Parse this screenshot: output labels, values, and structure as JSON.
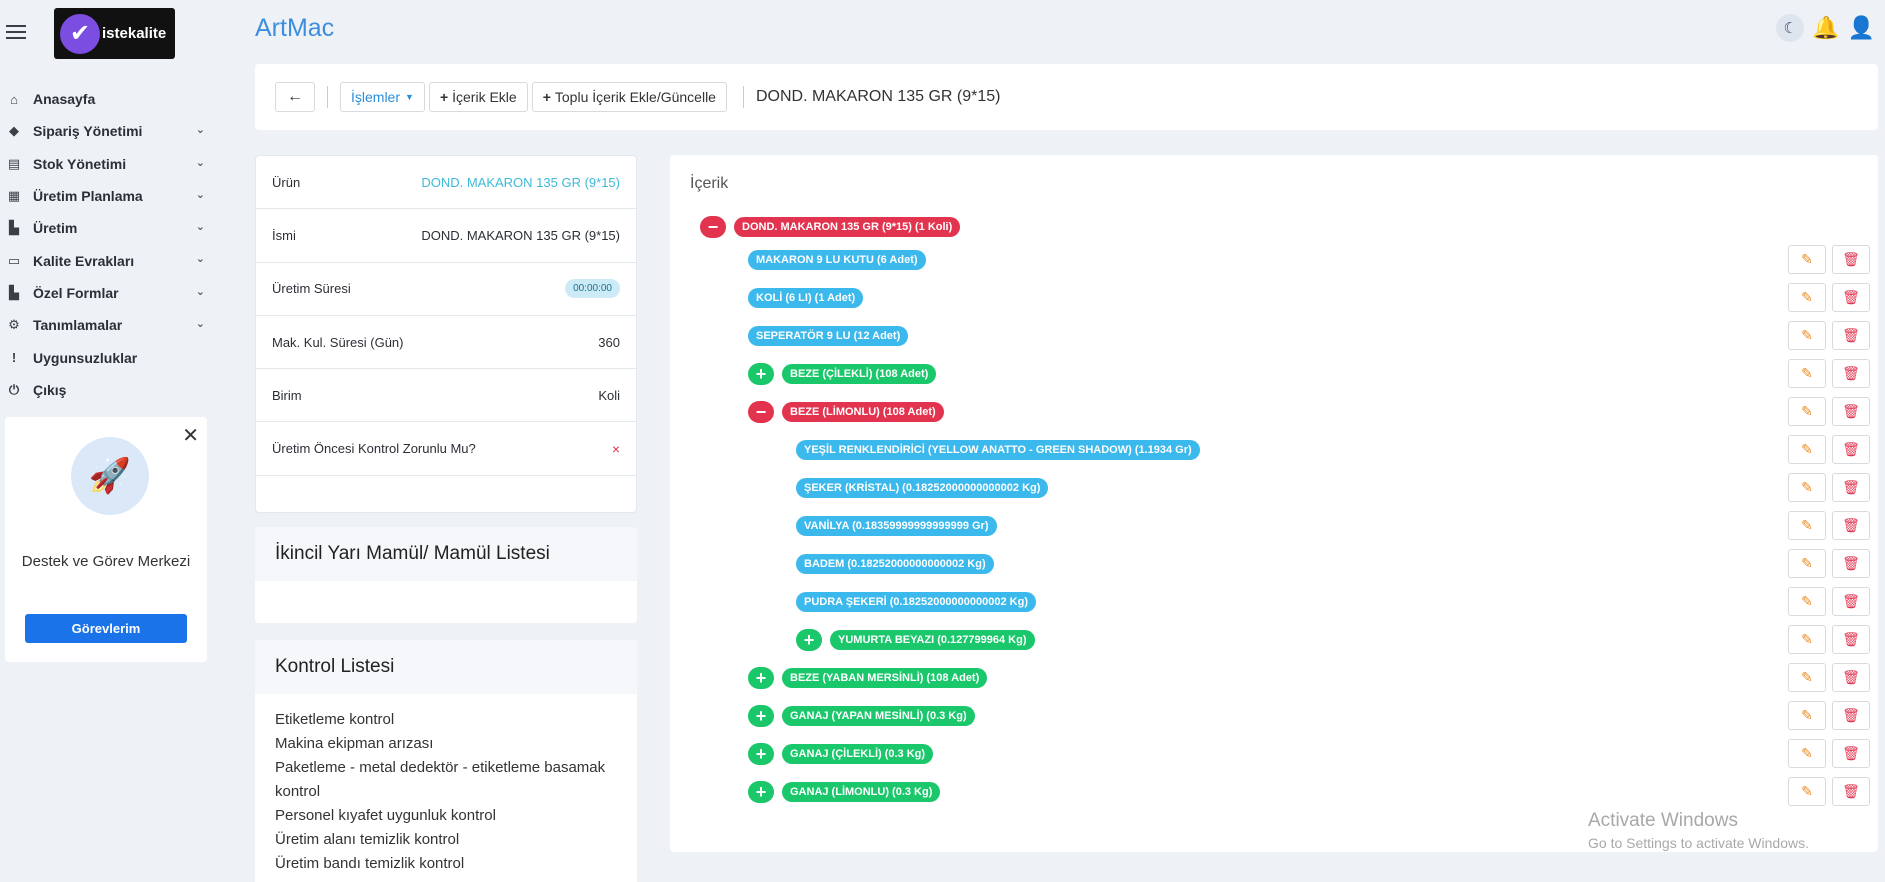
{
  "app": {
    "title": "ArtMac",
    "logo_text": "istekalite"
  },
  "sidebar": {
    "items": [
      {
        "label": "Anasayfa",
        "icon": "home-icon",
        "expandable": false
      },
      {
        "label": "Sipariş Yönetimi",
        "icon": "tag-icon",
        "expandable": true
      },
      {
        "label": "Stok Yönetimi",
        "icon": "cash-register-icon",
        "expandable": true
      },
      {
        "label": "Üretim Planlama",
        "icon": "calendar-check-icon",
        "expandable": true
      },
      {
        "label": "Üretim",
        "icon": "industry-icon",
        "expandable": true
      },
      {
        "label": "Kalite Evrakları",
        "icon": "folder-open-icon",
        "expandable": true
      },
      {
        "label": "Özel Formlar",
        "icon": "industry-icon",
        "expandable": true
      },
      {
        "label": "Tanımlamalar",
        "icon": "user-cog-icon",
        "expandable": true
      },
      {
        "label": "Uygunsuzluklar",
        "icon": "exclamation-icon",
        "expandable": false
      },
      {
        "label": "Çıkış",
        "icon": "power-icon",
        "expandable": false
      }
    ]
  },
  "support": {
    "title": "Destek ve Görev Merkezi",
    "button": "Görevlerim"
  },
  "toolbar": {
    "actions_label": "İşlemler",
    "add_label": "İçerik Ekle",
    "bulk_label": "Toplu İçerik Ekle/Güncelle",
    "breadcrumb": "DOND. MAKARON 135 GR (9*15)"
  },
  "properties": [
    {
      "label": "Ürün",
      "value": "DOND. MAKARON 135 GR (9*15)",
      "type": "link"
    },
    {
      "label": "İsmi",
      "value": "DOND. MAKARON 135 GR (9*15)",
      "type": "text"
    },
    {
      "label": "Üretim Süresi",
      "value": "00:00:00",
      "type": "badge"
    },
    {
      "label": "Mak. Kul. Süresi (Gün)",
      "value": "360",
      "type": "text"
    },
    {
      "label": "Birim",
      "value": "Koli",
      "type": "text"
    },
    {
      "label": "Üretim Öncesi Kontrol Zorunlu Mu?",
      "value": "×",
      "type": "flag"
    }
  ],
  "secondary": {
    "title": "İkincil Yarı Mamül/ Mamül Listesi"
  },
  "checklist": {
    "title": "Kontrol Listesi",
    "items": [
      "Etiketleme kontrol",
      "Makina ekipman arızası",
      "Paketleme - metal dedektör - etiketleme basamak kontrol",
      "Personel kıyafet uygunluk kontrol",
      "Üretim alanı temizlik kontrol",
      "Üretim bandı temizlik kontrol"
    ]
  },
  "tree": {
    "title": "İçerik",
    "nodes": [
      {
        "label": "DOND. MAKARON 135 GR (9*15) (1 Koli)",
        "level": 0,
        "color": "red",
        "toggle": "minus",
        "actions": false
      },
      {
        "label": "MAKARON 9 LU KUTU (6 Adet)",
        "level": 1,
        "color": "blue",
        "toggle": null,
        "actions": true
      },
      {
        "label": "KOLİ (6 LI) (1 Adet)",
        "level": 1,
        "color": "blue",
        "toggle": null,
        "actions": true
      },
      {
        "label": "SEPERATÖR 9 LU (12 Adet)",
        "level": 1,
        "color": "blue",
        "toggle": null,
        "actions": true
      },
      {
        "label": "BEZE (ÇİLEKLİ) (108 Adet)",
        "level": 1,
        "color": "green",
        "toggle": "plus",
        "actions": true
      },
      {
        "label": "BEZE (LİMONLU) (108 Adet)",
        "level": 1,
        "color": "red",
        "toggle": "minus",
        "actions": true
      },
      {
        "label": "YEŞİL RENKLENDİRİCİ (YELLOW ANATTO - GREEN SHADOW) (1.1934 Gr)",
        "level": 2,
        "color": "blue",
        "toggle": null,
        "actions": true
      },
      {
        "label": "ŞEKER (KRİSTAL) (0.18252000000000002 Kg)",
        "level": 2,
        "color": "blue",
        "toggle": null,
        "actions": true
      },
      {
        "label": "VANİLYA (0.18359999999999999 Gr)",
        "level": 2,
        "color": "blue",
        "toggle": null,
        "actions": true
      },
      {
        "label": "BADEM (0.18252000000000002 Kg)",
        "level": 2,
        "color": "blue",
        "toggle": null,
        "actions": true
      },
      {
        "label": "PUDRA ŞEKERİ (0.18252000000000002 Kg)",
        "level": 2,
        "color": "blue",
        "toggle": null,
        "actions": true
      },
      {
        "label": "YUMURTA BEYAZI (0.127799964 Kg)",
        "level": 2,
        "color": "green",
        "toggle": "plus",
        "actions": true
      },
      {
        "label": "BEZE (YABAN MERSİNLİ) (108 Adet)",
        "level": 1,
        "color": "green",
        "toggle": "plus",
        "actions": true
      },
      {
        "label": "GANAJ (YAPAN MESİNLİ) (0.3 Kg)",
        "level": 1,
        "color": "green",
        "toggle": "plus",
        "actions": true
      },
      {
        "label": "GANAJ (ÇİLEKLİ) (0.3 Kg)",
        "level": 1,
        "color": "green",
        "toggle": "plus",
        "actions": true
      },
      {
        "label": "GANAJ (LİMONLU) (0.3 Kg)",
        "level": 1,
        "color": "green",
        "toggle": "plus",
        "actions": true
      }
    ]
  },
  "watermark": {
    "title": "Activate Windows",
    "subtitle": "Go to Settings to activate Windows."
  },
  "colors": {
    "accent": "#3d8fde",
    "red": "#e2344f",
    "blue": "#3bb8ec",
    "green": "#1bc76b",
    "edit": "#f08a1d"
  }
}
